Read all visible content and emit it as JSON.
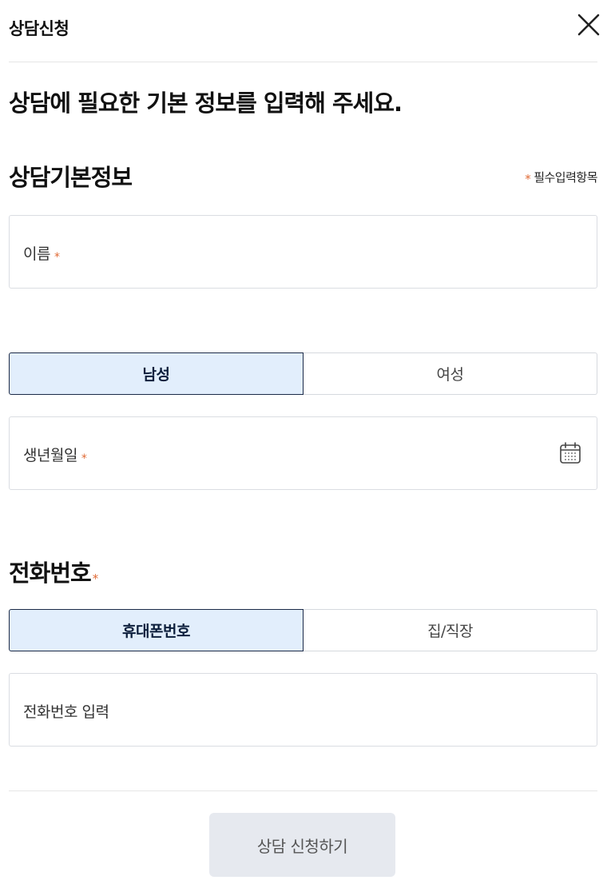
{
  "header": {
    "title": "상담신청",
    "close_icon": "close-icon"
  },
  "intro": "상담에 필요한 기본 정보를 입력해 주세요.",
  "basic_section": {
    "title": "상담기본정보",
    "required_mark": "*",
    "required_note": "필수입력항목"
  },
  "name_field": {
    "label": "이름",
    "required_mark": "*",
    "value": ""
  },
  "gender": {
    "options": [
      "남성",
      "여성"
    ],
    "selected": "남성"
  },
  "birth_field": {
    "label": "생년월일",
    "required_mark": "*",
    "value": "",
    "icon": "calendar-icon"
  },
  "phone_section": {
    "title": "전화번호",
    "required_mark": "*"
  },
  "phone_type": {
    "options": [
      "휴대폰번호",
      "집/직장"
    ],
    "selected": "휴대폰번호"
  },
  "phone_field": {
    "placeholder": "전화번호 입력",
    "value": ""
  },
  "submit_label": "상담 신청하기",
  "colors": {
    "accent_star": "#e06a35",
    "selected_bg": "#e2eefc",
    "selected_border": "#1b2a47",
    "submit_bg": "#e6e9ef"
  }
}
